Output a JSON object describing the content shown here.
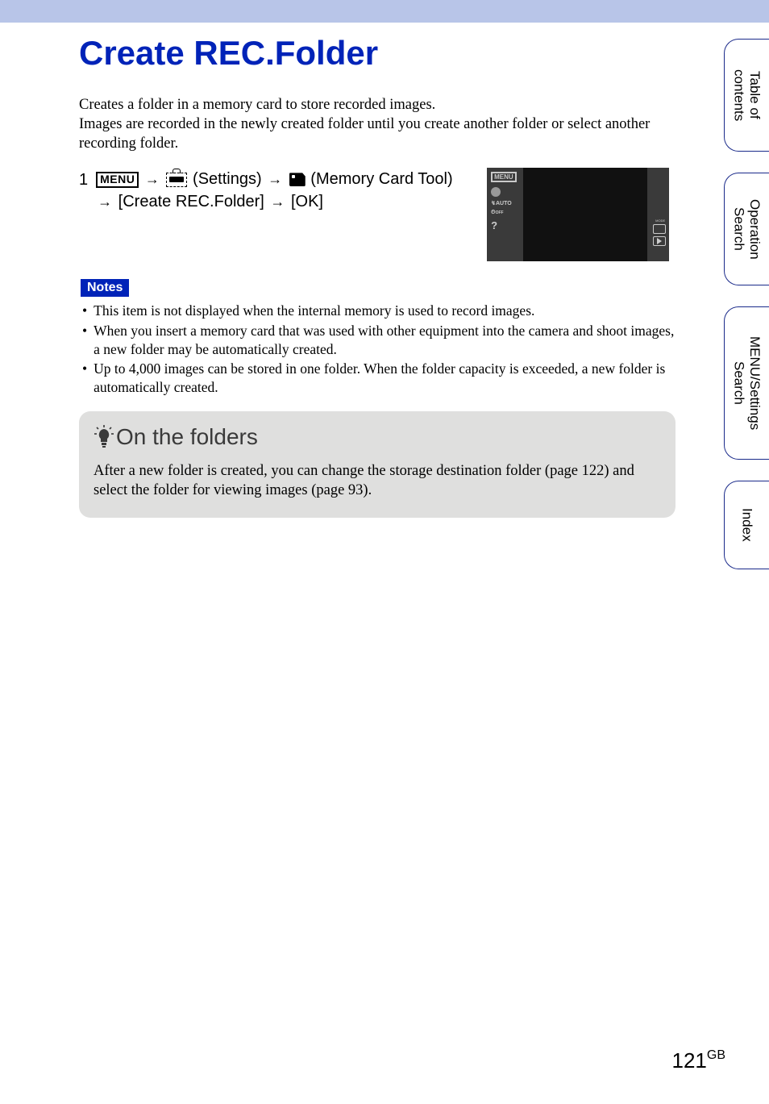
{
  "page": {
    "title": "Create REC.Folder",
    "intro": "Creates a folder in a memory card to store recorded images.\nImages are recorded in the newly created folder until you create another folder or select another recording folder.",
    "page_number": "121",
    "page_suffix": "GB"
  },
  "step": {
    "num": "1",
    "menu_label": "MENU",
    "settings_label": " (Settings) ",
    "tool_label": " (Memory Card Tool) ",
    "create_label": " [Create REC.Folder] ",
    "ok_label": " [OK]",
    "arrow": "→"
  },
  "thumb": {
    "menu": "MENU",
    "auto": "↯AUTO",
    "off": "OFF"
  },
  "notes": {
    "label": "Notes",
    "items": [
      "This item is not displayed when the internal memory is used to record images.",
      "When you insert a memory card that was used with other equipment into the camera and shoot images, a new folder may be automatically created.",
      "Up to 4,000 images can be stored in one folder. When the folder capacity is exceeded, a new folder is automatically created."
    ]
  },
  "tip": {
    "title": "On the folders",
    "body": "After a new folder is created, you can change the storage destination folder (page 122) and select the folder for viewing images (page 93)."
  },
  "sidetabs": {
    "toc": "Table of\ncontents",
    "op": "Operation\nSearch",
    "menu": "MENU/Settings\nSearch",
    "index": "Index"
  }
}
